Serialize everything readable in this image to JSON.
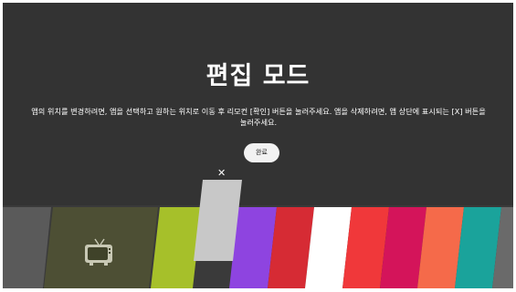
{
  "title": "편집 모드",
  "instructions": "앱의 위치를 변경하려면, 앱을 선택하고 원하는 위치로 이동 후 리모컨 [확인] 버튼을 눌러주세요. 앱을 삭제하려면, 앱 상단에 표시되는 [X] 버튼을 눌러주세요.",
  "done_button": "완료",
  "close_glyph": "✕",
  "colors": {
    "background": "#333333",
    "tiles": [
      "#5a5a5a",
      "#4d4f34",
      "#a6c02a",
      "#c8c8c8",
      "#8e44e0",
      "#d62b34",
      "#ffffff",
      "#f0383a",
      "#d4145a",
      "#f56a4a",
      "#1aa39b",
      "#6a6a6a"
    ]
  },
  "launcher": {
    "apps": [
      {
        "name": "app-tile-gray"
      },
      {
        "name": "app-tile-tv"
      },
      {
        "name": "app-tile-lime"
      },
      {
        "name": "app-tile-selected"
      },
      {
        "name": "app-tile-purple"
      },
      {
        "name": "app-tile-red"
      },
      {
        "name": "app-tile-white"
      },
      {
        "name": "app-tile-red-orange"
      },
      {
        "name": "app-tile-magenta"
      },
      {
        "name": "app-tile-coral"
      },
      {
        "name": "app-tile-teal"
      },
      {
        "name": "app-tile-gray-end"
      }
    ]
  }
}
